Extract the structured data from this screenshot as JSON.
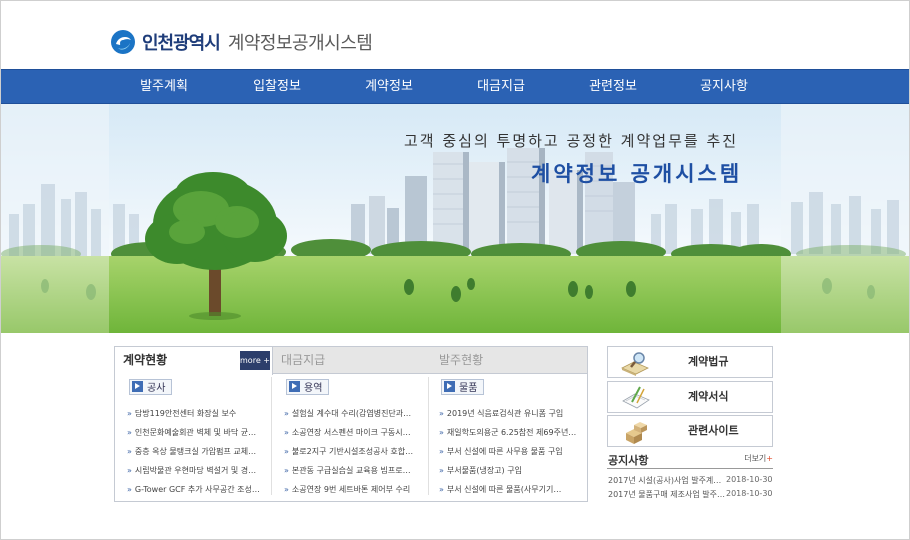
{
  "header": {
    "logo_main": "인천광역시",
    "logo_sub": "계약정보공개시스템"
  },
  "nav": {
    "items": [
      {
        "label": "발주계획"
      },
      {
        "label": "입찰정보"
      },
      {
        "label": "계약정보"
      },
      {
        "label": "대금지급"
      },
      {
        "label": "관련정보"
      },
      {
        "label": "공지사항"
      }
    ]
  },
  "banner": {
    "slogan": "고객 중심의 투명하고 공정한 계약업무를 추진",
    "title": "계약정보  공개시스템"
  },
  "tabbox": {
    "tabs": [
      {
        "label": "계약현황"
      },
      {
        "label": "대금지급"
      },
      {
        "label": "발주현황"
      }
    ],
    "more_label": "more +",
    "columns": [
      {
        "label": "공사",
        "items": [
          "담방119안전센터 화장실 보수",
          "인천문화예술회관 벽체 및 바닥 균…",
          "중층 옥상 물탱크실 가압펌프 교체…",
          "시립박물관 우현마당 벽설거 및 경…",
          "G-Tower GCF 추가 사무공간 조성…"
        ]
      },
      {
        "label": "용역",
        "items": [
          "설험실 계수대 수리(감염병진단과…",
          "소공연장 서스펜션 마이크 구동시…",
          "불로2지구 기반시설조성공사 호합…",
          "본관동 구급실습실 교육용 빔프로…",
          "소공연장 9번 세트바톤 제어부 수리"
        ]
      },
      {
        "label": "물품",
        "items": [
          "2019년 식음료검식관 유니폼 구입",
          "재일학도의용군 6.25참전 제69주년…",
          "부서 신설에 따른 사무용 물품 구입",
          "부서물품(냉장고) 구입",
          "부서 신설에 따른 물품(사무기기…"
        ]
      }
    ]
  },
  "quick_links": [
    {
      "label": "계약법규",
      "icon": "magnifier-book-icon"
    },
    {
      "label": "계약서식",
      "icon": "document-pen-icon"
    },
    {
      "label": "관련사이트",
      "icon": "boxes-icon"
    }
  ],
  "notice": {
    "title": "공지사항",
    "more_label": "더보기",
    "more_plus": "+",
    "rows": [
      {
        "title": "2017년 시설(공사)사업 발주계획…",
        "date": "2018-10-30"
      },
      {
        "title": "2017년 물품구매 제조사업 발주…",
        "date": "2018-10-30"
      }
    ]
  },
  "colors": {
    "nav_bg": "#2b62b4",
    "brand": "#1e4fa3",
    "more_bg": "#2c3e6b"
  }
}
